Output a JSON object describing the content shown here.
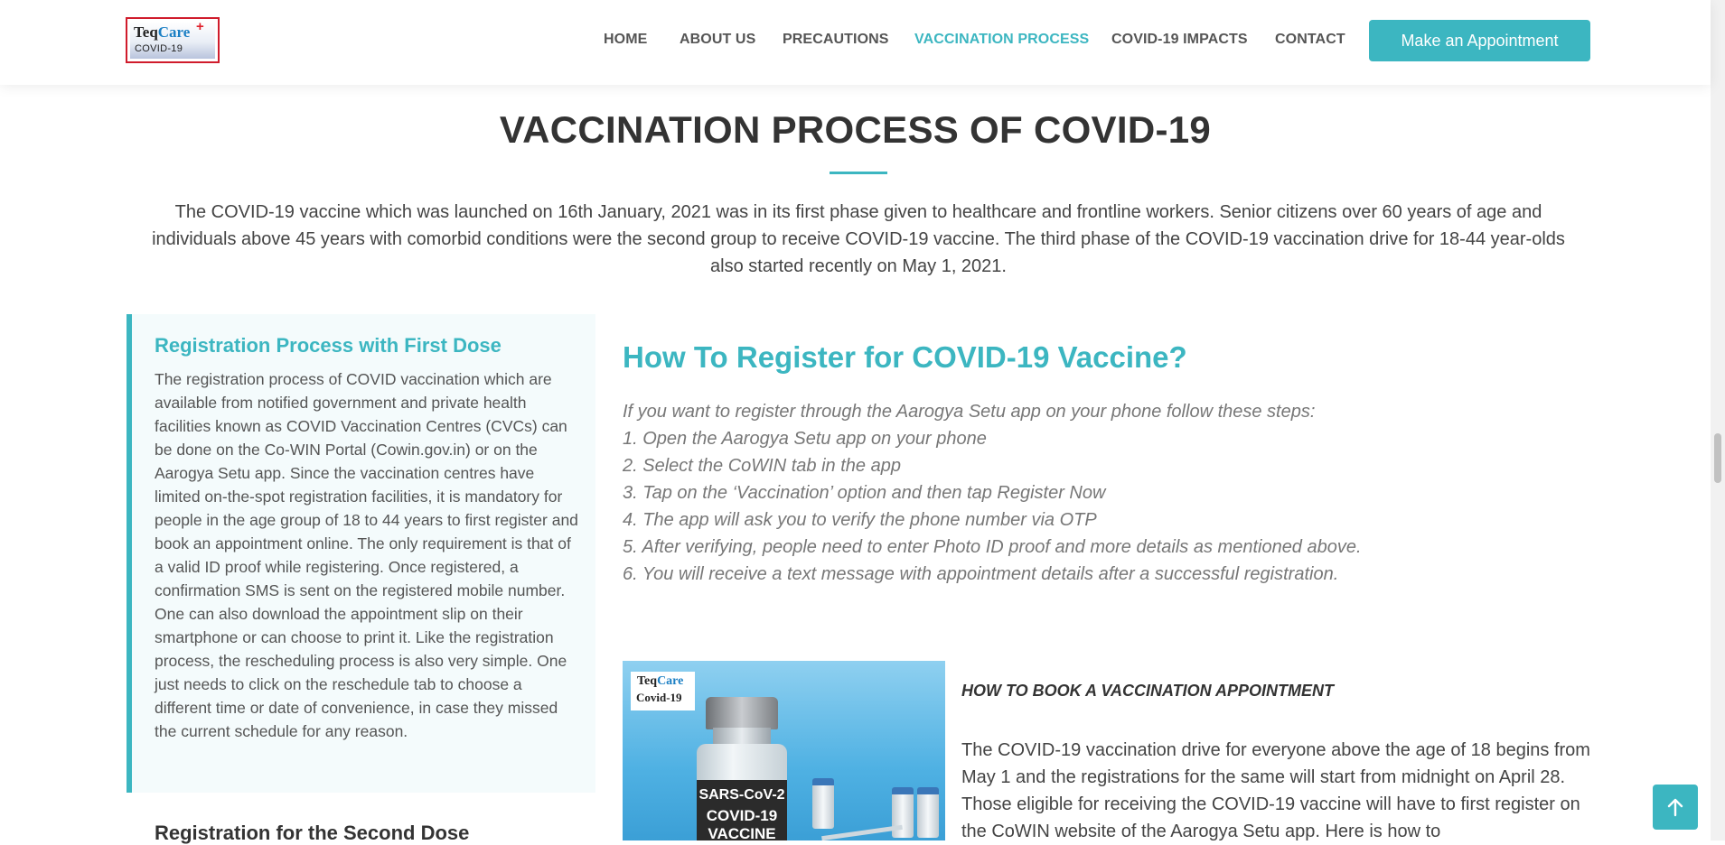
{
  "header": {
    "logo": {
      "word_a": "Teq",
      "word_b": "Care",
      "plus": "+",
      "sub": "COVID-19"
    },
    "nav": [
      {
        "label": "HOME"
      },
      {
        "label": "ABOUT US"
      },
      {
        "label": "PRECAUTIONS"
      },
      {
        "label": "VACCINATION PROCESS",
        "active": true
      },
      {
        "label": "COVID-19 IMPACTS"
      },
      {
        "label": "CONTACT"
      }
    ],
    "cta_label": "Make an Appointment"
  },
  "colors": {
    "accent": "#3cb6c1",
    "heading": "#333333",
    "text": "#444444",
    "logo_border": "#d01c2c"
  },
  "main": {
    "title": "VACCINATION PROCESS OF COVID-19",
    "intro": "The COVID-19 vaccine which was launched on 16th January, 2021 was in its first phase given to healthcare and frontline workers. Senior citizens over 60 years of age and individuals above 45 years with comorbid conditions were the second group to receive COVID-19 vaccine. The third phase of the COVID-19 vaccination drive for 18-44 year-olds also started recently on May 1, 2021.",
    "sidebar": {
      "heading": "Registration Process with First Dose",
      "body": "The registration process of COVID vaccination which are available from notified government and private health facilities known as COVID Vaccination Centres (CVCs) can be done on the Co-WIN Portal (Cowin.gov.in) or on the Aarogya Setu app. Since the vaccination centres have limited on-the-spot registration facilities, it is mandatory for people in the age group of 18 to 44 years to first register and book an appointment online. The only requirement is that of a valid ID proof while registering. Once registered, a confirmation SMS is sent on the registered mobile number. One can also download the appointment slip on their smartphone or can choose to print it. Like the registration process, the rescheduling process is also very simple. One just needs to click on the reschedule tab to choose a different time or date of convenience, in case they missed the current schedule for any reason.",
      "next_heading": "Registration for the Second Dose"
    },
    "how_to": {
      "title": "How To Register for COVID-19 Vaccine?",
      "steps": [
        "If you want to register through the Aarogya Setu app on your phone follow these steps:",
        "1. Open the Aarogya Setu app on your phone",
        "2. Select the CoWIN tab in the app",
        "3. Tap on the ‘Vaccination’ option and then tap Register Now",
        "4. The app will ask you to verify the phone number via OTP",
        "5. After verifying, people need to enter Photo ID proof and more details as mentioned above.",
        "6. You will receive a text message with appointment details after a successful registration."
      ]
    },
    "image": {
      "logo_line1_a": "Teq",
      "logo_line1_b": "Care",
      "logo_line2": "Covid-19",
      "label_1": "SARS-CoV-2",
      "label_2": "COVID-19",
      "label_3": "VACCINE"
    },
    "booking": {
      "heading": "HOW TO BOOK A VACCINATION APPOINTMENT",
      "body": "The COVID-19 vaccination drive for everyone above the age of 18 begins from May 1 and the registrations for the same will start from midnight on April 28. Those eligible for receiving the COVID-19 vaccine will have to first register on the CoWIN website of the Aarogya Setu app. Here is how to"
    }
  },
  "back_to_top_icon": "arrow-up-icon"
}
